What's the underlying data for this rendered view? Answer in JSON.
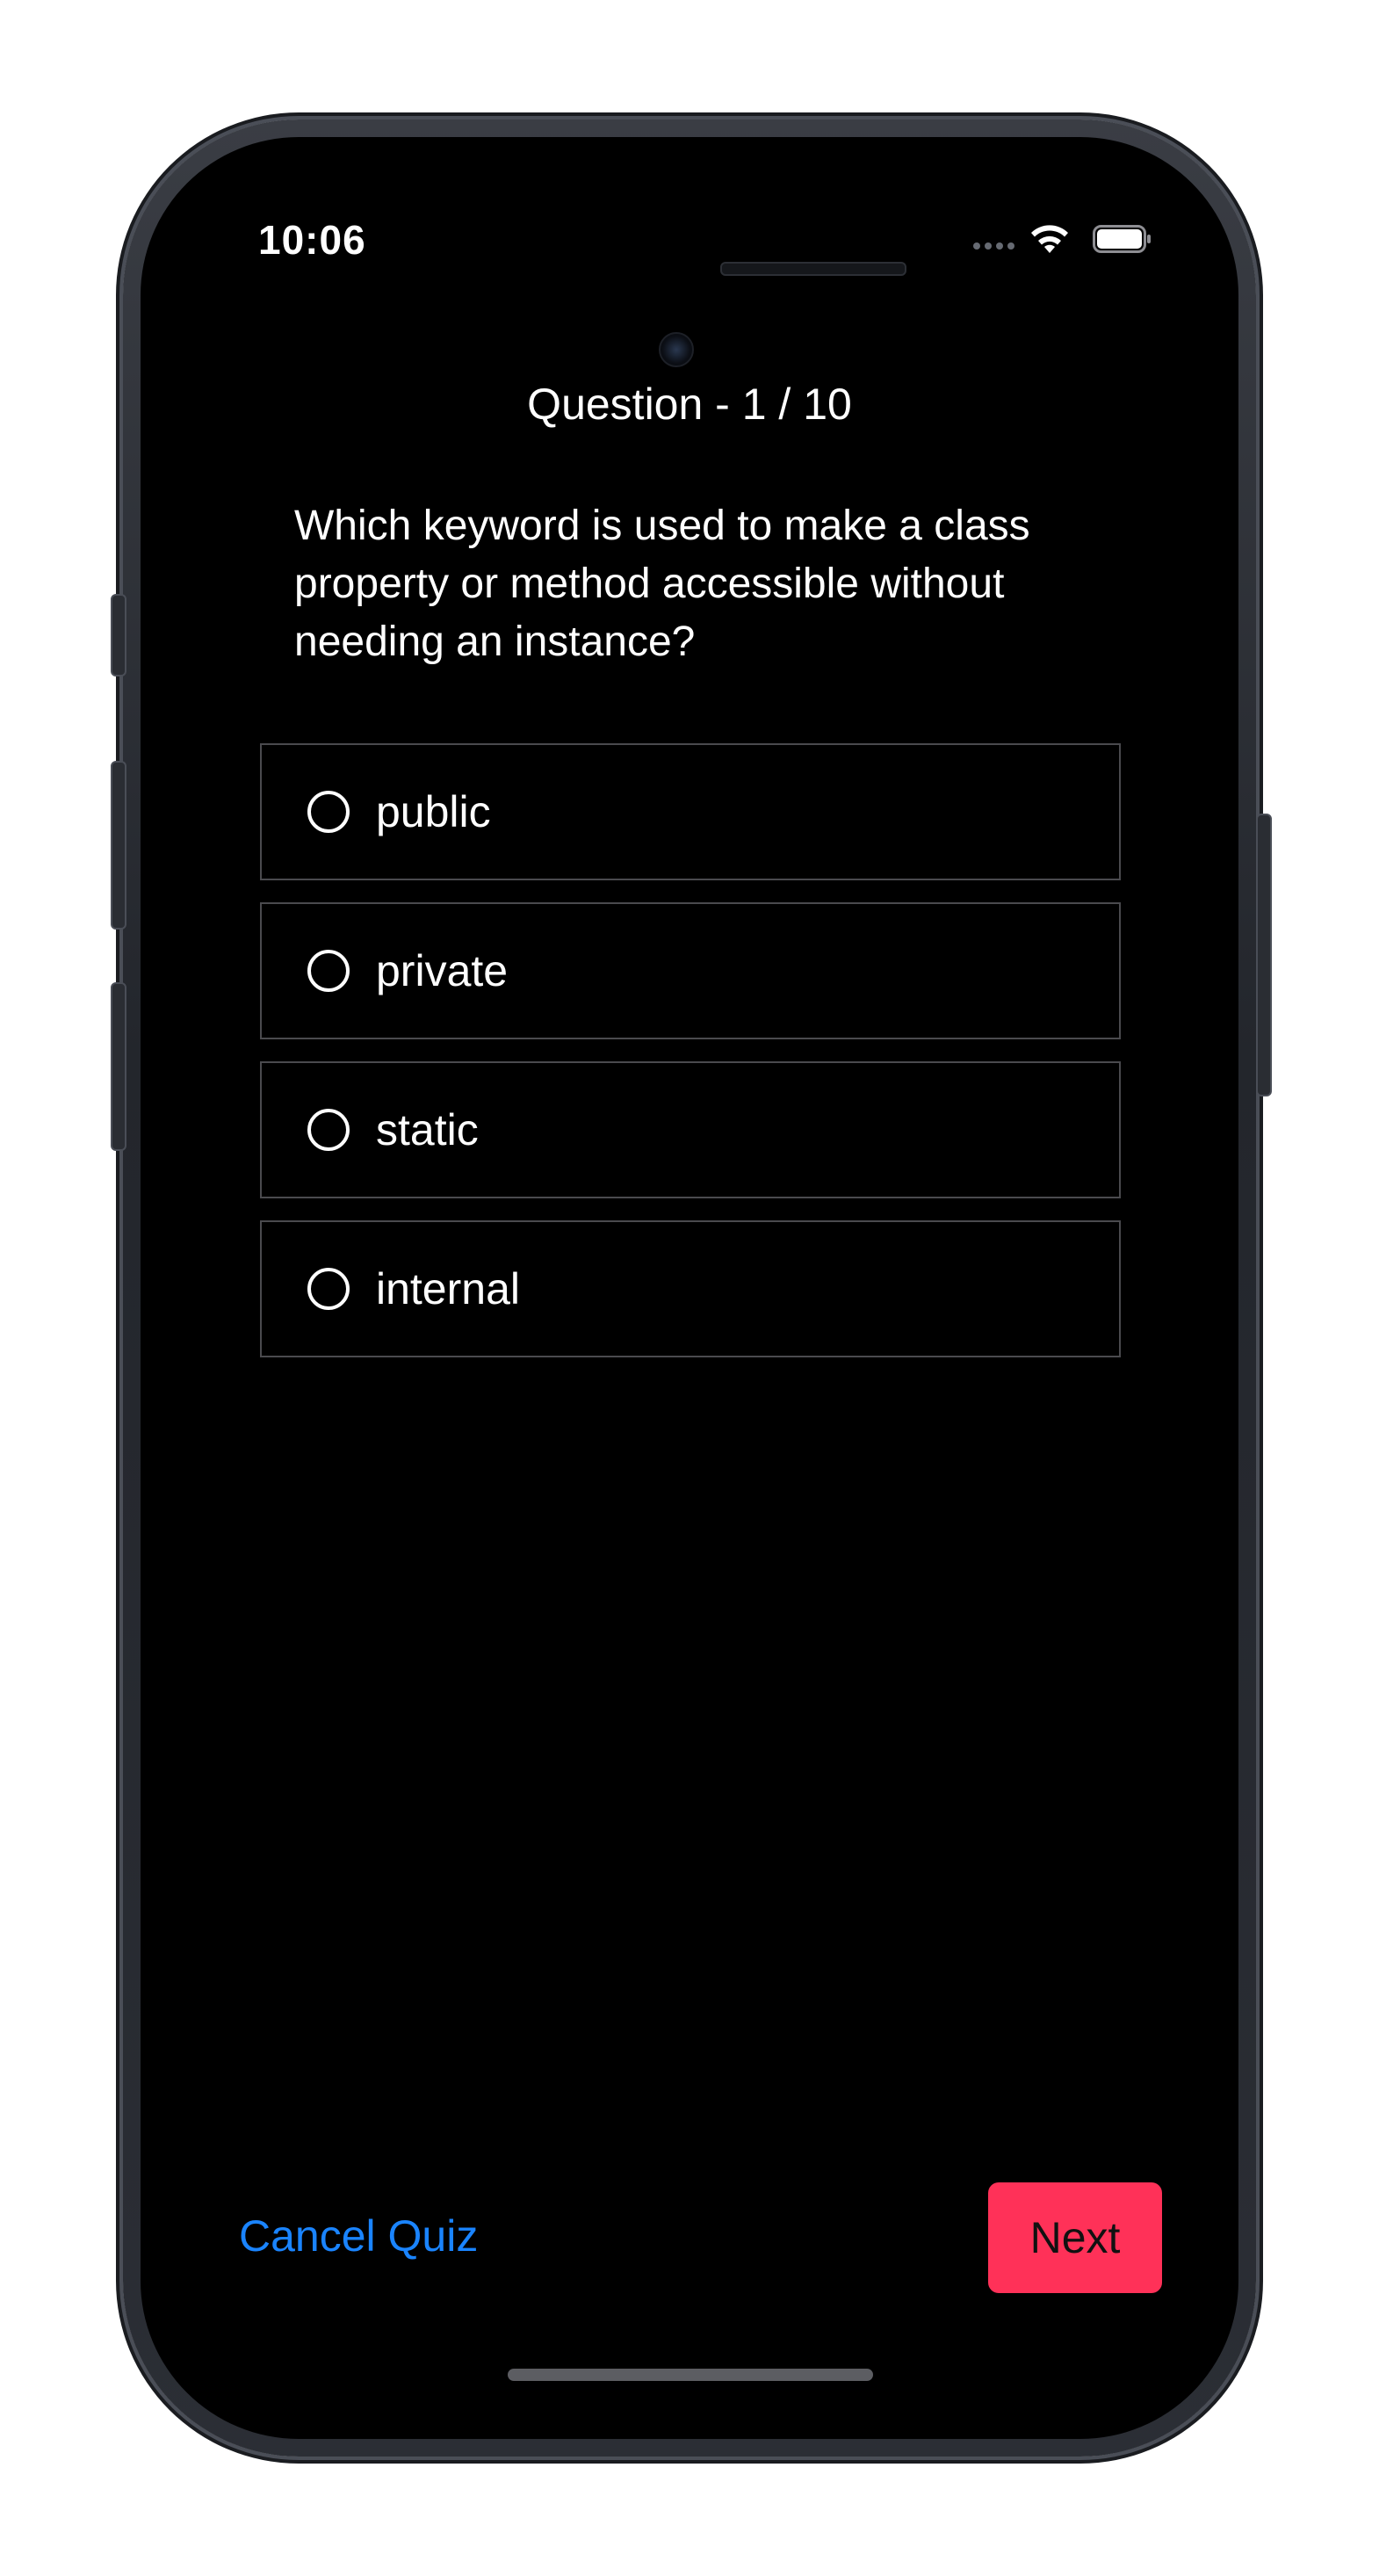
{
  "status_bar": {
    "time": "10:06"
  },
  "quiz": {
    "progress_label": "Question - 1 / 10",
    "question": "Which keyword is used to make a class property or method accessible without needing an instance?",
    "options": [
      {
        "label": "public"
      },
      {
        "label": "private"
      },
      {
        "label": "static"
      },
      {
        "label": "internal"
      }
    ]
  },
  "actions": {
    "cancel_label": "Cancel Quiz",
    "next_label": "Next"
  },
  "colors": {
    "background": "#000000",
    "text": "#ffffff",
    "link_blue": "#1a84ff",
    "next_button": "#ff3158",
    "option_border": "#4a4a4e"
  },
  "icons": {
    "wifi": "wifi-icon",
    "battery": "battery-icon",
    "radio": "radio-unchecked-icon"
  }
}
